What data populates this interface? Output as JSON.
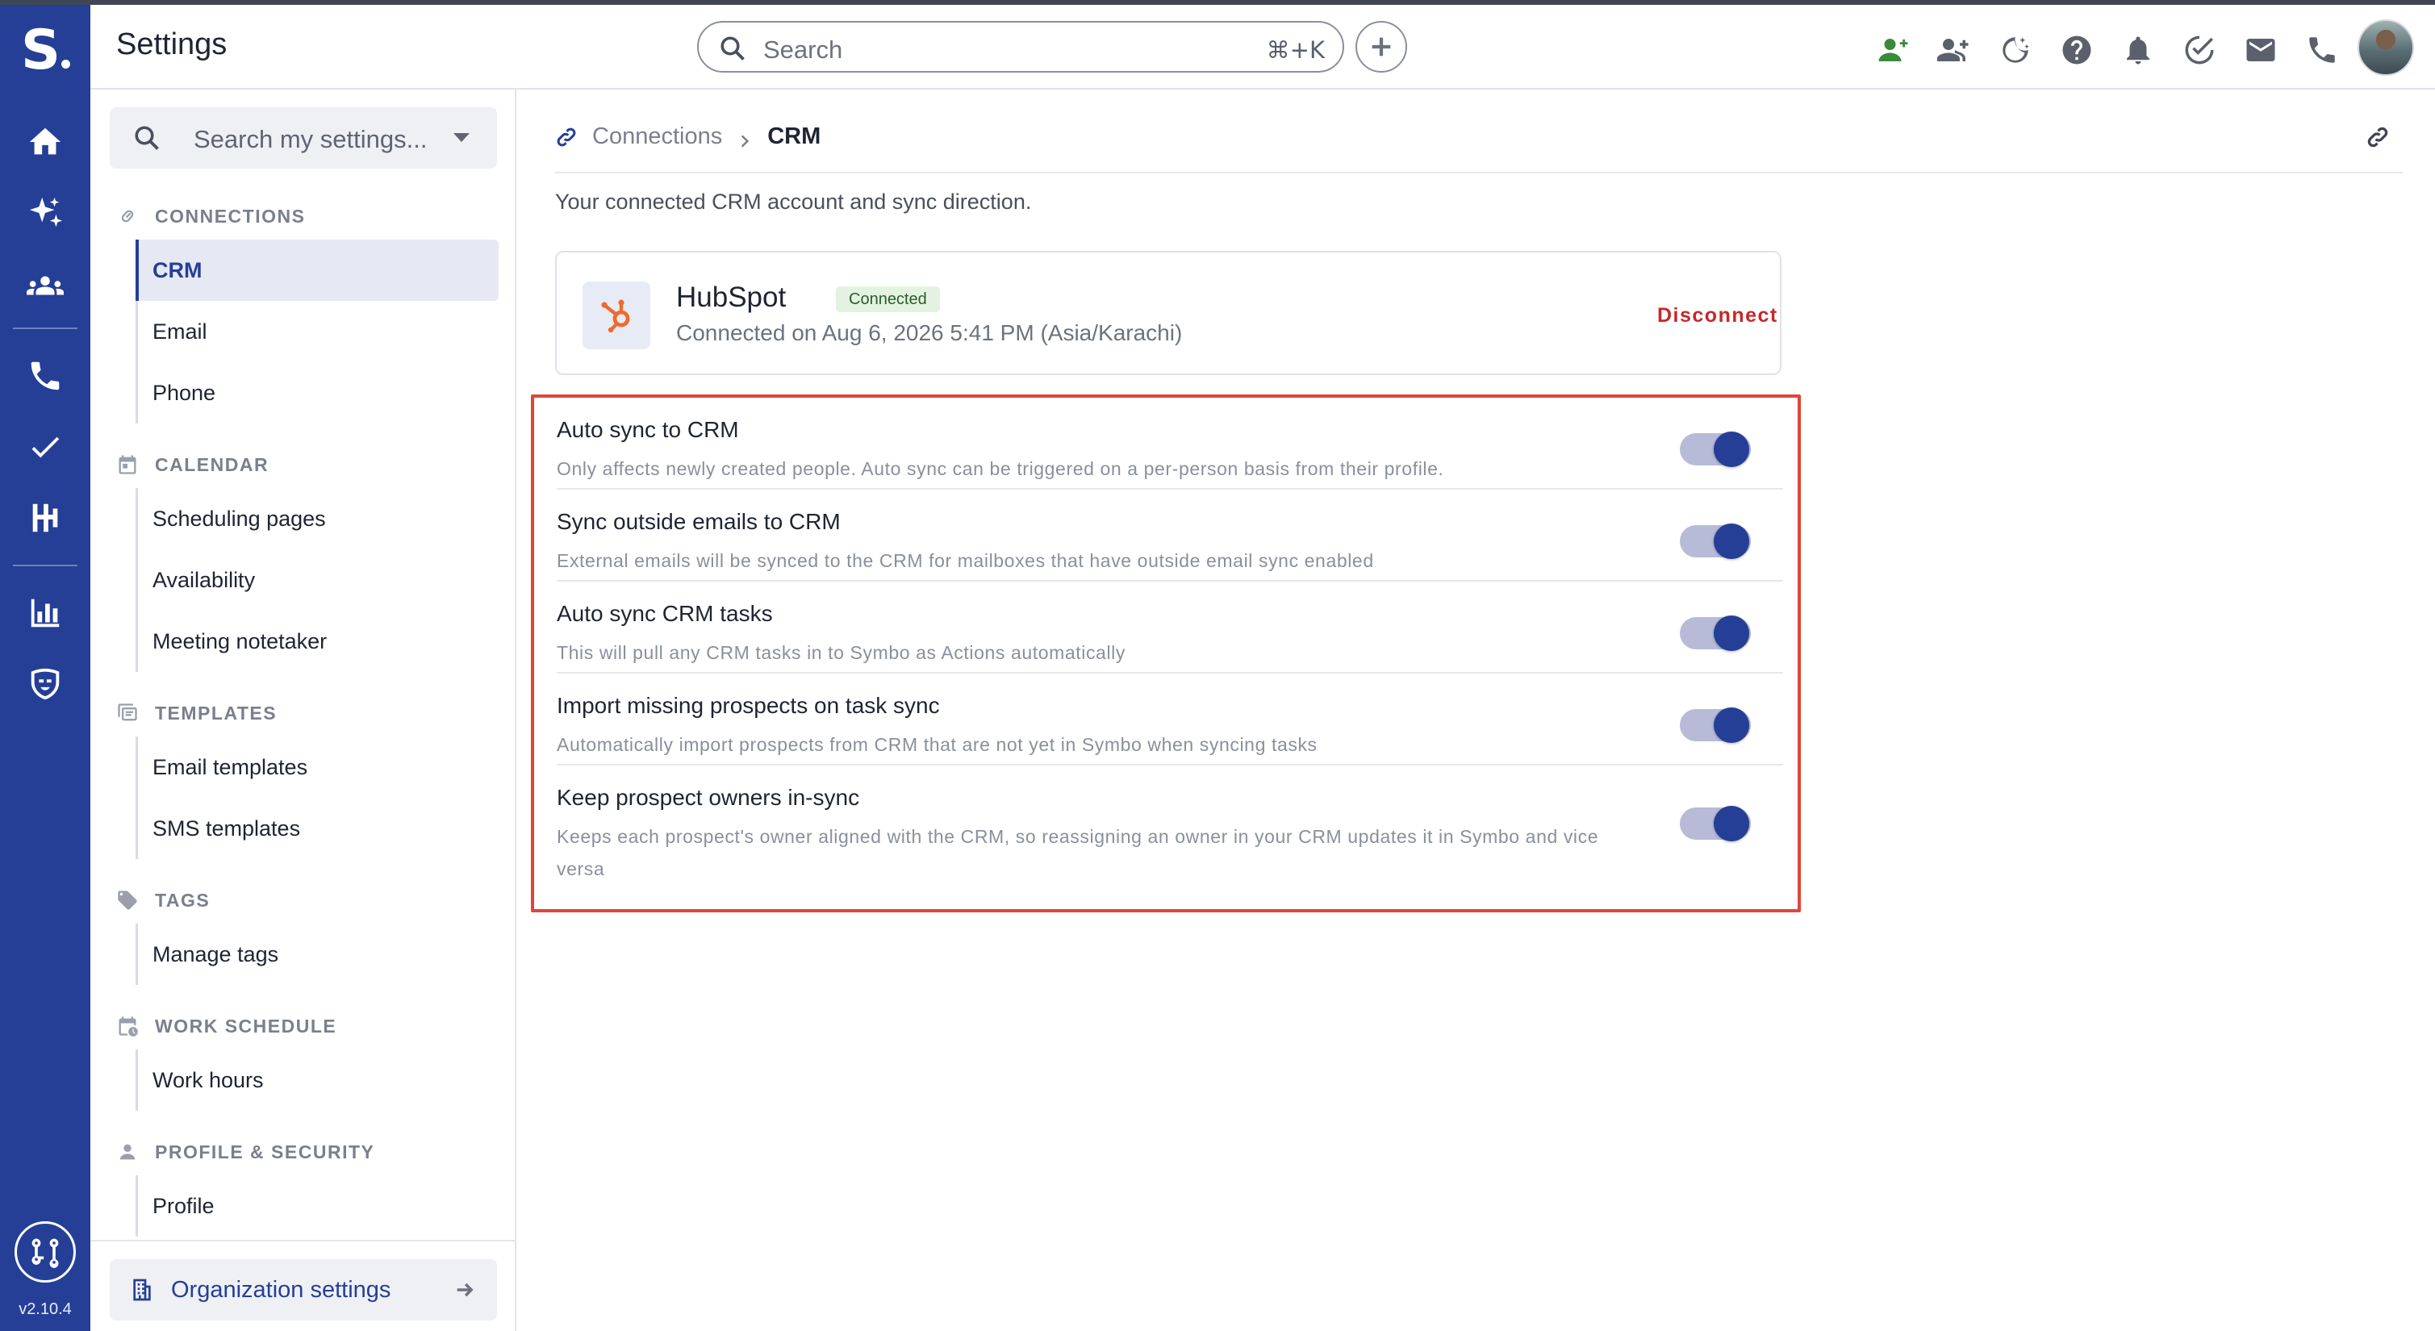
{
  "app": {
    "title": "Settings",
    "version": "v2.10.4"
  },
  "header": {
    "search_placeholder": "Search",
    "search_shortcut": "⌘+K",
    "icons": [
      "add-person-icon",
      "add-group-icon",
      "do-not-disturb-icon",
      "help-icon",
      "bell-icon",
      "check-circle-icon",
      "mail-icon",
      "phone-icon"
    ]
  },
  "rail": {
    "items": [
      "home-icon",
      "sparkles-icon",
      "people-icon",
      "phone-icon",
      "check-icon",
      "sequence-icon",
      "chart-icon",
      "masks-icon"
    ]
  },
  "sidebar": {
    "search_placeholder": "Search my settings...",
    "sections": [
      {
        "heading": "CONNECTIONS",
        "icon": "link-icon",
        "items": [
          "CRM",
          "Email",
          "Phone"
        ],
        "active": "CRM"
      },
      {
        "heading": "CALENDAR",
        "icon": "calendar-icon",
        "items": [
          "Scheduling pages",
          "Availability",
          "Meeting notetaker"
        ]
      },
      {
        "heading": "TEMPLATES",
        "icon": "templates-icon",
        "items": [
          "Email templates",
          "SMS templates"
        ]
      },
      {
        "heading": "TAGS",
        "icon": "tag-icon",
        "items": [
          "Manage tags"
        ]
      },
      {
        "heading": "WORK SCHEDULE",
        "icon": "schedule-icon",
        "items": [
          "Work hours"
        ]
      },
      {
        "heading": "PROFILE & SECURITY",
        "icon": "person-icon",
        "items": [
          "Profile"
        ]
      }
    ],
    "org_settings": "Organization settings"
  },
  "main": {
    "breadcrumb": {
      "parent": "Connections",
      "current": "CRM"
    },
    "subtitle": "Your connected CRM account and sync direction.",
    "crm_card": {
      "name": "HubSpot",
      "status": "Connected",
      "connected_on": "Connected on Aug 6, 2026 5:41 PM (Asia/Karachi)",
      "action": "Disconnect",
      "status_color": "#2c5e2a",
      "action_color": "#c62828"
    },
    "options": [
      {
        "title": "Auto sync to CRM",
        "desc": "Only affects newly created people. Auto sync can be triggered on a per-person basis from their profile.",
        "enabled": true
      },
      {
        "title": "Sync outside emails to CRM",
        "desc": "External emails will be synced to the CRM for mailboxes that have outside email sync enabled",
        "enabled": true
      },
      {
        "title": "Auto sync CRM tasks",
        "desc": "This will pull any CRM tasks in to Symbo as Actions automatically",
        "enabled": true
      },
      {
        "title": "Import missing prospects on task sync",
        "desc": "Automatically import prospects from CRM that are not yet in Symbo when syncing tasks",
        "enabled": true
      },
      {
        "title": "Keep prospect owners in-sync",
        "desc": "Keeps each prospect's owner aligned with the CRM, so reassigning an owner in your CRM updates it in Symbo and vice versa",
        "enabled": true
      }
    ]
  },
  "colors": {
    "brand": "#253f96",
    "highlight_border": "#e0453a"
  }
}
